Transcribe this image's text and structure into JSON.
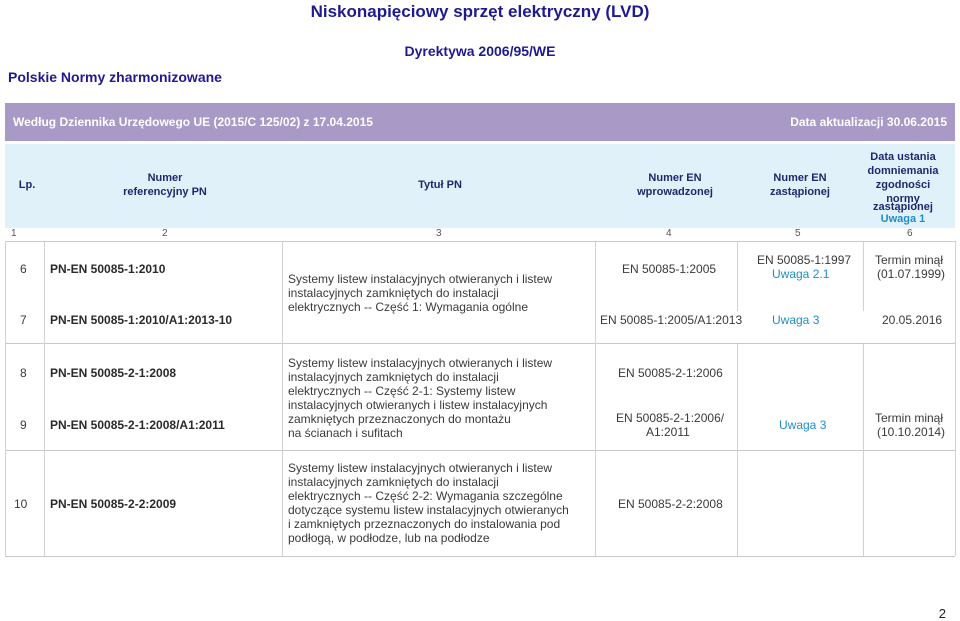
{
  "header": {
    "title": "Niskonapięciowy sprzęt elektryczny (LVD)",
    "directive": "Dyrektywa 2006/95/WE",
    "subtitle": "Polskie Normy zharmonizowane"
  },
  "band": {
    "left_text": "Według Dziennika Urzędowego UE (2015/C 125/02) z 17.04.2015",
    "right_text": "Data aktualizacji  30.06.2015"
  },
  "columns": {
    "lp": "Lp.",
    "ref_line1": "Numer",
    "ref_line2": "referencyjny PN",
    "title": "Tytuł PN",
    "en_in_line1": "Numer EN",
    "en_in_line2": "wprowadzonej",
    "en_rep_line1": "Numer EN",
    "en_rep_line2": "zastąpionej",
    "date_line1": "Data ustania",
    "date_line2": "domniemania",
    "date_line3": "zgodności",
    "date_line4": "normy",
    "date_line5": "zastąpionej",
    "date_note": "Uwaga 1",
    "n1": "1",
    "n2": "2",
    "n3": "3",
    "n4": "4",
    "n5": "5",
    "n6": "6"
  },
  "rows": {
    "r6": {
      "lp": "6",
      "ref": "PN-EN 50085-1:2010",
      "en": "EN 50085-1:2005",
      "rep": "EN 50085-1:1997",
      "rep_note": "Uwaga 2.1",
      "date1": "Termin minął",
      "date2": "(01.07.1999)"
    },
    "r7": {
      "lp": "7",
      "ref": "PN-EN 50085-1:2010/A1:2013-10",
      "en": "EN 50085-1:2005/A1:2013",
      "note": "Uwaga 3",
      "date": "20.05.2016"
    },
    "t67": [
      "Systemy listew instalacyjnych otwieranych i listew",
      "instalacyjnych zamkniętych do instalacji",
      "elektrycznych -- Część 1: Wymagania ogólne"
    ],
    "r8": {
      "lp": "8",
      "ref": "PN-EN 50085-2-1:2008",
      "en": "EN 50085-2-1:2006"
    },
    "r9": {
      "lp": "9",
      "ref": "PN-EN 50085-2-1:2008/A1:2011",
      "en1": "EN 50085-2-1:2006/",
      "en2": "A1:2011",
      "note": "Uwaga 3",
      "date1": "Termin minął",
      "date2": "(10.10.2014)"
    },
    "t89": [
      "Systemy listew instalacyjnych otwieranych i listew",
      "instalacyjnych zamkniętych do instalacji",
      "elektrycznych -- Część 2-1: Systemy listew",
      "instalacyjnych otwieranych i listew instalacyjnych",
      "zamkniętych przeznaczonych do montażu",
      "na ścianach i sufitach"
    ],
    "r10": {
      "lp": "10",
      "ref": "PN-EN 50085-2-2:2009",
      "en": "EN 50085-2-2:2008"
    },
    "t10": [
      "Systemy listew instalacyjnych otwieranych i listew",
      "instalacyjnych zamkniętych do instalacji",
      "elektrycznych -- Część 2-2: Wymagania szczególne",
      "dotyczące systemu listew instalacyjnych otwieranych",
      "i zamkniętych przeznaczonych do instalowania pod",
      "podłogą, w podłodze, lub na podłodze"
    ]
  },
  "page_number": "2"
}
